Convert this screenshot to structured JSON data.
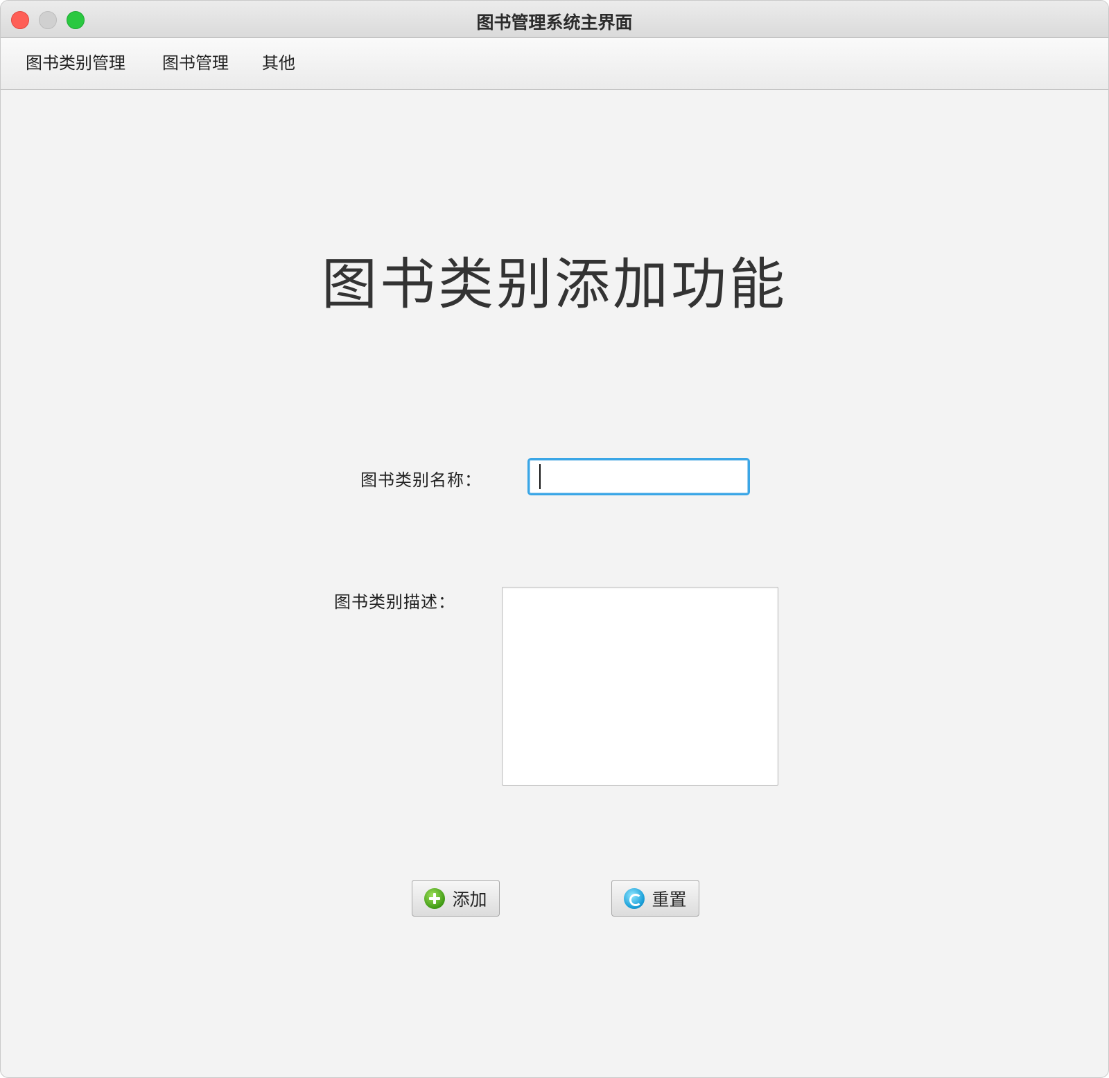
{
  "window": {
    "title": "图书管理系统主界面"
  },
  "menubar": {
    "items": [
      {
        "label": "图书类别管理"
      },
      {
        "label": "图书管理"
      },
      {
        "label": "其他"
      }
    ]
  },
  "main": {
    "heading": "图书类别添加功能",
    "category_name": {
      "label": "图书类别名称：",
      "value": ""
    },
    "category_description": {
      "label": "图书类别描述：",
      "value": ""
    },
    "buttons": {
      "add_label": "添加",
      "add_icon": "add-icon",
      "reset_label": "重置",
      "reset_icon": "reset-icon"
    }
  },
  "colors": {
    "focus_ring": "#3aa6e6",
    "close": "#fe5f57",
    "minimize": "#d0d0d0",
    "maximize": "#2ac840"
  }
}
